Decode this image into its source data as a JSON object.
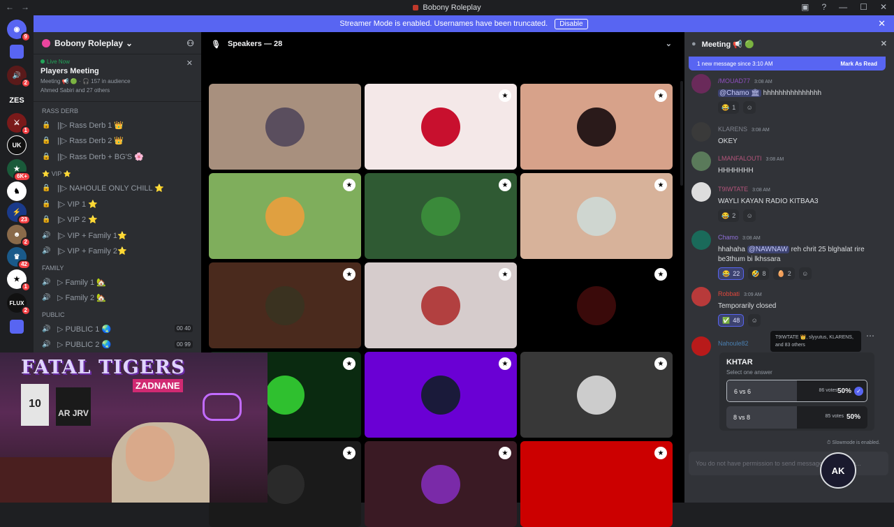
{
  "titlebar": {
    "title": "Bobony Roleplay"
  },
  "banner": {
    "text": "Streamer Mode is enabled. Usernames have been truncated.",
    "button": "Disable"
  },
  "guilds": {
    "badges": [
      "9",
      "2",
      "1",
      "6K+",
      "23",
      "2",
      "42",
      "1",
      "2"
    ],
    "labels": [
      "ZES",
      "UK",
      "FLUX"
    ]
  },
  "server": {
    "name": "Bobony Roleplay",
    "live_label": "Live Now",
    "live_event": "Players Meeting",
    "live_meta": "Meeting 📢 🟢 · 🎧 157 in audience",
    "live_members": "Ahmed Sabiri and 27 others"
  },
  "channels": {
    "categories": [
      "RASS DERB",
      "⭐ VIP ⭐",
      "FAMILY",
      "PUBLIC"
    ],
    "items": [
      {
        "name": "||▷ Rass Derb 1 👑",
        "icon": "lock-icon",
        "count": ""
      },
      {
        "name": "||▷ Rass Derb 2 👑",
        "icon": "lock-icon",
        "count": ""
      },
      {
        "name": "||▷ Rass Derb + BG'S 🌸",
        "icon": "lock-icon",
        "count": ""
      },
      {
        "name": "||▷ NAHOULE ONLY CHILL ⭐",
        "icon": "lock-icon",
        "count": ""
      },
      {
        "name": "|▷ VIP 1 ⭐",
        "icon": "lock-icon",
        "count": ""
      },
      {
        "name": "|▷ VIP 2 ⭐",
        "icon": "lock-icon",
        "count": ""
      },
      {
        "name": "|▷ VIP + Family 1⭐",
        "icon": "speaker-icon",
        "count": ""
      },
      {
        "name": "|▷ VIP + Family 2⭐",
        "icon": "speaker-icon",
        "count": ""
      },
      {
        "name": "▷ Family 1 🏡",
        "icon": "speaker-icon",
        "count": ""
      },
      {
        "name": "▷ Family 2 🏡",
        "icon": "speaker-icon",
        "count": ""
      },
      {
        "name": "▷ PUBLIC 1 🌏",
        "icon": "speaker-icon",
        "count": "00 40"
      },
      {
        "name": "▷ PUBLIC 2 🌏",
        "icon": "speaker-icon",
        "count": "00 99"
      }
    ]
  },
  "stage": {
    "header": "Speakers — 28"
  },
  "tiles": [
    {
      "bg": "#a8907e",
      "av": "#5a4e5e",
      "mod": false
    },
    {
      "bg": "#f4e8e8",
      "av": "#c8102e",
      "mod": true
    },
    {
      "bg": "#d7a28a",
      "av": "#2a1a1a",
      "mod": true
    },
    {
      "bg": "#7fae5c",
      "av": "#e0a040",
      "mod": true
    },
    {
      "bg": "#2f5a33",
      "av": "#3a8a3a",
      "mod": true
    },
    {
      "bg": "#d7b29a",
      "av": "#cfd6d0",
      "mod": true
    },
    {
      "bg": "#4a2a1d",
      "av": "#3a3220",
      "mod": true
    },
    {
      "bg": "#d6cccc",
      "av": "#b24040",
      "mod": true
    },
    {
      "bg": "#000000",
      "av": "#3a0a0a",
      "mod": true
    },
    {
      "bg": "#0a2a10",
      "av": "#2fc02f",
      "mod": true
    },
    {
      "bg": "#6a00d4",
      "av": "#1a1a3a",
      "mod": true
    },
    {
      "bg": "#383838",
      "av": "#cccccc",
      "mod": true
    },
    {
      "bg": "#1a1a1a",
      "av": "#2a2a2a",
      "mod": true
    },
    {
      "bg": "#3a1a24",
      "av": "#7a2aa8",
      "mod": true
    },
    {
      "bg": "#cc0000",
      "av": "#cc0000",
      "mod": true
    }
  ],
  "chat": {
    "channel": "Meeting 📢 🟢",
    "newbar": "1 new message since 3:10 AM",
    "mark_read": "Mark As Read",
    "messages": [
      {
        "author": "/MOUAD77",
        "color": "#8f4fbf",
        "time": "3:08 AM",
        "mention": "@Chamo 🏛",
        "text": "hhhhhhhhhhhhhhh",
        "reacts": [
          [
            "😂",
            "1",
            false
          ]
        ]
      },
      {
        "author": "KLARENS",
        "color": "#80848e",
        "time": "3:08 AM",
        "mention": "",
        "text": "OKEY",
        "reacts": []
      },
      {
        "author": "LMANFALOUTI",
        "color": "#b5547b",
        "time": "3:08 AM",
        "mention": "",
        "text": "HHHHHHH",
        "reacts": []
      },
      {
        "author": "T9IWTATE",
        "color": "#b5547b",
        "time": "3:08 AM",
        "mention": "",
        "text": "WAYLI KAYAN RADIO KITBAA3",
        "reacts": [
          [
            "😂",
            "2",
            false
          ]
        ]
      },
      {
        "author": "Chamo",
        "color": "#8f6fd8",
        "time": "3:08 AM",
        "mention": "@NAWNAW",
        "text_pre": "hhahaha",
        "text": "reh chrit 25 blghalat rire be3thum bi lkhssara",
        "reacts": [
          [
            "😂",
            "22",
            true
          ],
          [
            "🤣",
            "8",
            false
          ],
          [
            "🥚",
            "2",
            false
          ]
        ]
      },
      {
        "author": "Robbati",
        "color": "#e0483d",
        "time": "3:09 AM",
        "mention": "",
        "text": "Temporarily closed",
        "reacts": [
          [
            "✅",
            "48",
            true
          ]
        ]
      },
      {
        "author": "Nahoule82",
        "color": "#4a7fb0",
        "time": "",
        "mention": "",
        "text": "",
        "reacts": []
      }
    ],
    "tooltip": "T9IWTATE 👑, slyyutus, KLARENS, and 83 others",
    "poll": {
      "question": "KHTAR",
      "hint": "Select one answer",
      "options": [
        {
          "label": "6 vs 6",
          "votes": "86 votes",
          "percent": "50%",
          "fill": 0.5,
          "selected": true
        },
        {
          "label": "8 vs 8",
          "votes": "85 votes",
          "percent": "50%",
          "fill": 0.5,
          "selected": false
        }
      ]
    },
    "slowmode": "Slowmode is enabled.",
    "composer": "You do not have permission to send messages in this cha..."
  },
  "overlay": {
    "team": "FATAL TIGERS",
    "streamer": "ZADNANE",
    "jersey1": "10",
    "jersey2": "AR JRV",
    "logo": "AK"
  }
}
